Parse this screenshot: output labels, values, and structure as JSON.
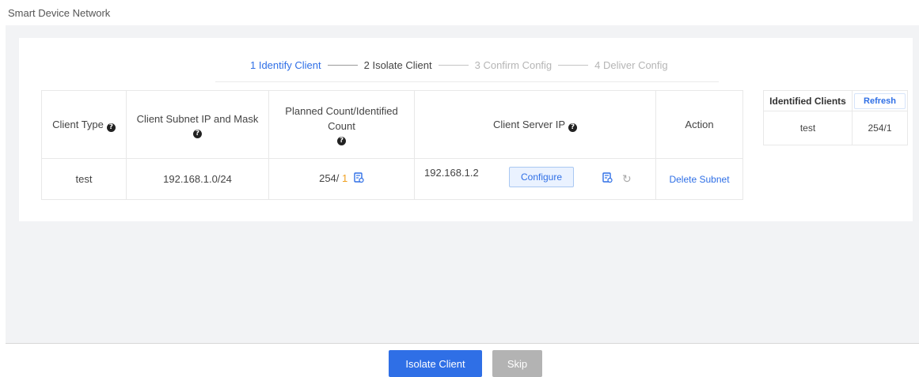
{
  "page": {
    "title": "Smart Device Network"
  },
  "steps": [
    {
      "label": "1 Identify Client",
      "state": "done"
    },
    {
      "label": "2 Isolate Client",
      "state": "current"
    },
    {
      "label": "3 Confirm Config",
      "state": "pending"
    },
    {
      "label": "4 Deliver Config",
      "state": "pending"
    }
  ],
  "table": {
    "headers": {
      "client_type": "Client Type",
      "subnet": "Client Subnet IP and Mask",
      "count": "Planned Count/Identified Count",
      "server_ip": "Client Server IP",
      "action": "Action"
    },
    "rows": [
      {
        "client_type": "test",
        "subnet": "192.168.1.0/24",
        "planned": "254/",
        "identified": "1",
        "server_ip": "192.168.1.2",
        "configure_label": "Configure",
        "delete_label": "Delete Subnet"
      }
    ]
  },
  "identified_clients": {
    "title": "Identified Clients",
    "refresh_label": "Refresh",
    "rows": [
      {
        "name": "test",
        "count": "254/1"
      }
    ]
  },
  "footer": {
    "primary_label": "Isolate Client",
    "skip_label": "Skip"
  },
  "colors": {
    "accent": "#2f6fe6",
    "highlight": "#f0a020",
    "disabled": "#b3b3b3"
  },
  "icons": {
    "help": "question-circle-icon",
    "list": "list-detail-icon",
    "refresh": "refresh-icon"
  }
}
